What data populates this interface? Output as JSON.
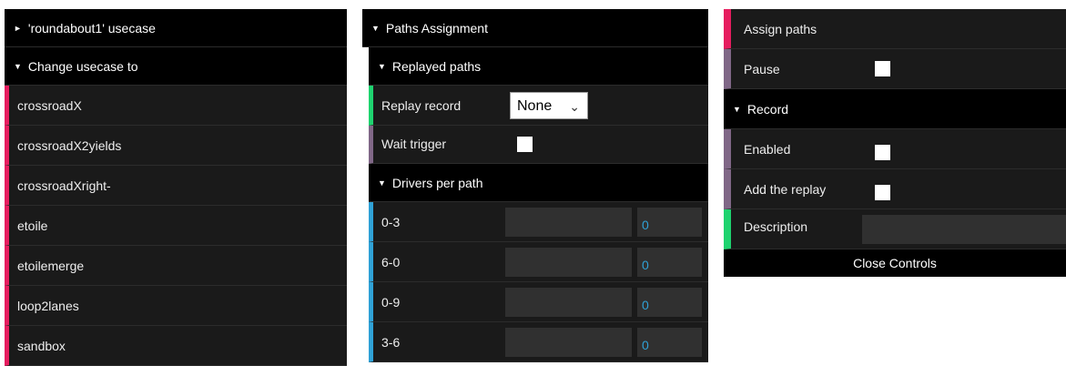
{
  "left_panel": {
    "usecase_folder": "'roundabout1' usecase",
    "change_folder": "Change usecase to",
    "items": [
      "crossroadX",
      "crossroadX2yields",
      "crossroadXright-",
      "etoile",
      "etoilemerge",
      "loop2lanes",
      "sandbox"
    ]
  },
  "middle_panel": {
    "paths_folder": "Paths Assignment",
    "replayed_folder": "Replayed paths",
    "replay_record_label": "Replay record",
    "replay_record_value": "None",
    "wait_trigger_label": "Wait trigger",
    "drivers_folder": "Drivers per path",
    "drivers": [
      {
        "label": "0-3",
        "value": "0"
      },
      {
        "label": "6-0",
        "value": "0"
      },
      {
        "label": "0-9",
        "value": "0"
      },
      {
        "label": "3-6",
        "value": "0"
      }
    ]
  },
  "right_panel": {
    "assign_paths": "Assign paths",
    "pause_label": "Pause",
    "record_folder": "Record",
    "enabled_label": "Enabled",
    "add_replay_label": "Add the replay",
    "description_label": "Description",
    "close_controls": "Close Controls"
  },
  "icons": {
    "collapsed": "triangle-right-icon",
    "expanded": "triangle-down-icon",
    "dropdown": "chevron-down-icon"
  },
  "colors": {
    "function": "#e61d5f",
    "boolean": "#806787",
    "string": "#1ed36f",
    "number": "#2fa1d6"
  }
}
